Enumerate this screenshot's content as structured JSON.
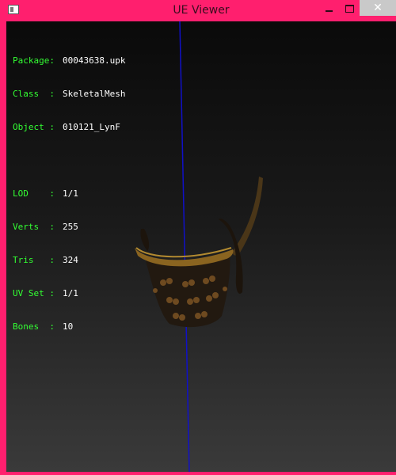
{
  "window": {
    "title": "UE Viewer",
    "close_glyph": "✕"
  },
  "info": {
    "package": {
      "label": "Package:",
      "value": "00043638.upk"
    },
    "class": {
      "label": "Class  :",
      "value": "SkeletalMesh"
    },
    "object": {
      "label": "Object :",
      "value": "010121_LynF"
    },
    "lod": {
      "label": "LOD    :",
      "value": "1/1"
    },
    "verts": {
      "label": "Verts  :",
      "value": "255"
    },
    "tris": {
      "label": "Tris   :",
      "value": "324"
    },
    "uvset": {
      "label": "UV Set :",
      "value": "1/1"
    },
    "bones": {
      "label": "Bones  :",
      "value": "10"
    }
  },
  "colors": {
    "titlebar": "#ff1f6e",
    "info_label": "#33ff33",
    "info_value": "#ffffff",
    "axis": "#1010c8"
  },
  "icons": {
    "app": "app-icon",
    "minimize": "minimize-icon",
    "maximize": "maximize-icon",
    "close": "close-icon"
  }
}
